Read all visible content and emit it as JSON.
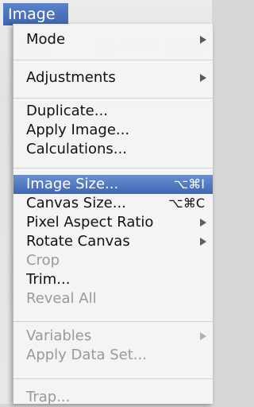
{
  "menubar": {
    "title": "Image"
  },
  "menu": {
    "items": [
      {
        "label": "Mode"
      },
      {
        "label": "Adjustments"
      },
      {
        "label": "Duplicate..."
      },
      {
        "label": "Apply Image..."
      },
      {
        "label": "Calculations..."
      },
      {
        "label": "Image Size...",
        "shortcut": "⌥⌘I"
      },
      {
        "label": "Canvas Size...",
        "shortcut": "⌥⌘C"
      },
      {
        "label": "Pixel Aspect Ratio"
      },
      {
        "label": "Rotate Canvas"
      },
      {
        "label": "Crop"
      },
      {
        "label": "Trim..."
      },
      {
        "label": "Reveal All"
      },
      {
        "label": "Variables"
      },
      {
        "label": "Apply Data Set..."
      },
      {
        "label": "Trap..."
      }
    ]
  },
  "colors": {
    "selection": "#4a73bd",
    "disabled_text": "#9a9a9a"
  },
  "icons": [
    "submenu-arrow-icon"
  ]
}
